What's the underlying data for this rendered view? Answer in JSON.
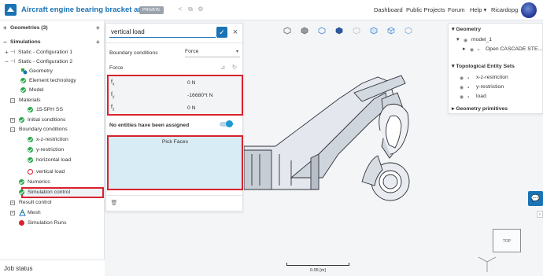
{
  "header": {
    "title": "Aircraft engine bearing bracket analysis",
    "badge": "PRIVATE",
    "nav": [
      "Dashboard",
      "Public Projects",
      "Forum",
      "Help ▾",
      "Ricardopg"
    ]
  },
  "tree": {
    "geometries": "Geometries (3)",
    "simulations": "Simulations",
    "items": [
      "Static - Configuration 1",
      "Static - Configuration 2",
      "Geometry",
      "Element technology",
      "Model",
      "Materials",
      "15-5PH SS",
      "Initial conditions",
      "Boundary conditions",
      "x-z-restriction",
      "y-restriction",
      "horizontal load",
      "vertical load",
      "Numerics",
      "Simulation control",
      "Result control",
      "Mesh",
      "Simulation Runs"
    ],
    "job_status": "Job status"
  },
  "panel": {
    "name_value": "vertical load",
    "bc_label": "Boundary conditions",
    "bc_value": "Force",
    "force_label": "Force",
    "rows": [
      {
        "sym": "f",
        "sub": "x",
        "val": "0 N"
      },
      {
        "sym": "f",
        "sub": "y",
        "val": "-16680*t N"
      },
      {
        "sym": "f",
        "sub": "z",
        "val": "0 N"
      }
    ],
    "no_entities": "No entities have been assigned",
    "pick_faces": "Pick Faces"
  },
  "right": {
    "geometry": "Geometry",
    "model": "model_1",
    "cascade": "Open CASCADE STE...",
    "topo": "Topological Entity Sets",
    "sets": [
      "x-z-restriction",
      "y-restriction",
      "load"
    ],
    "primitives": "Geometry primitives"
  },
  "viewport": {
    "cube_face": "TOP",
    "scale": "0.05 [m]"
  },
  "colors": {
    "accent": "#1a73b5",
    "ok": "#2aa84a",
    "error": "#d9232e",
    "pick_bg": "#d8ecf5"
  }
}
